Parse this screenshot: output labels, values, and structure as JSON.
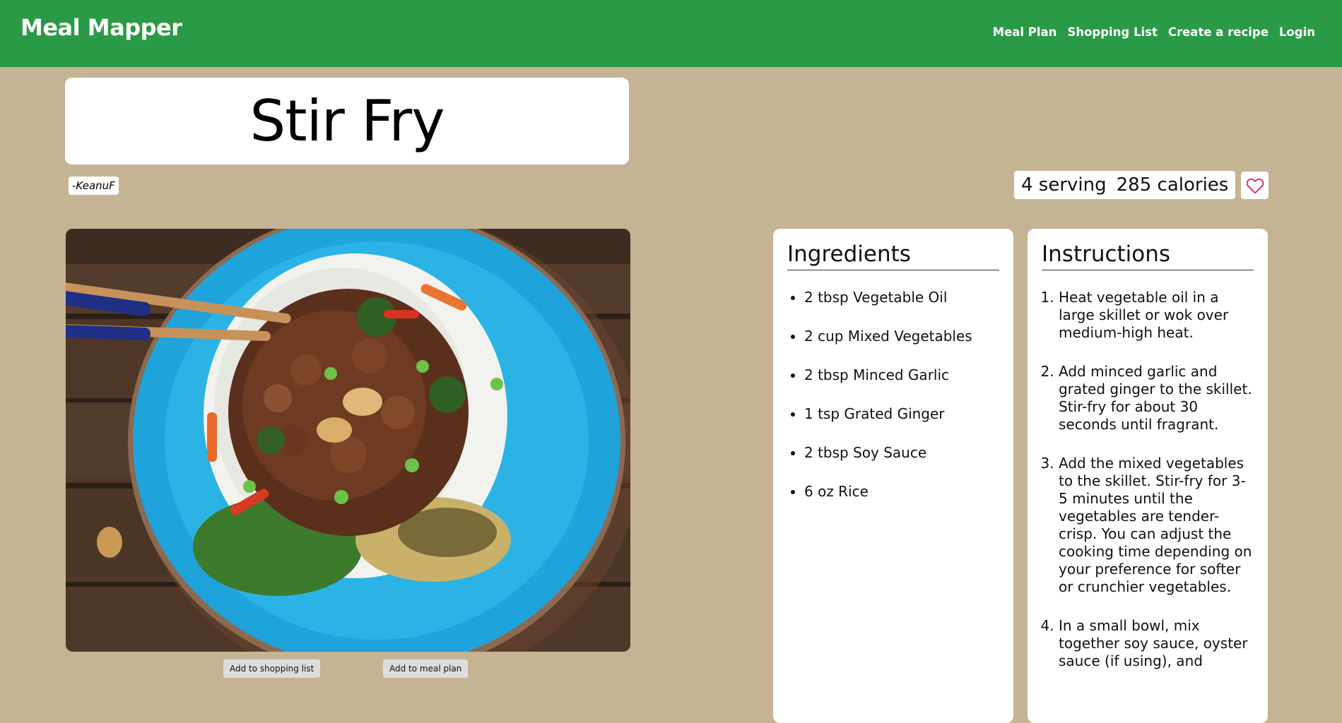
{
  "navbar": {
    "brand": "Meal Mapper",
    "links": [
      "Meal Plan",
      "Shopping List",
      "Create a recipe",
      "Login"
    ]
  },
  "recipe": {
    "title": "Stir Fry",
    "author": "-KeanuF",
    "servings": "4 serving",
    "calories": "285 calories",
    "favorite_icon": "heart-outline-icon",
    "image_alt": "Stir fry with chicken, cashews, vegetables and rice in a blue bowl with chopsticks"
  },
  "actions": {
    "add_shopping": "Add to shopping list",
    "add_meal_plan": "Add to meal plan"
  },
  "ingredients": {
    "heading": "Ingredients",
    "items": [
      "2 tbsp Vegetable Oil",
      "2 cup Mixed Vegetables",
      "2 tbsp Minced Garlic",
      "1 tsp Grated Ginger",
      "2 tbsp Soy Sauce",
      "6 oz Rice"
    ]
  },
  "instructions": {
    "heading": "Instructions",
    "steps": [
      "Heat vegetable oil in a large skillet or wok over medium-high heat.",
      "Add minced garlic and grated ginger to the skillet. Stir-fry for about 30 seconds until fragrant.",
      "Add the mixed vegetables to the skillet. Stir-fry for 3-5 minutes until the vegetables are tender-crisp. You can adjust the cooking time depending on your preference for softer or crunchier vegetables.",
      "In a small bowl, mix together soy sauce, oyster sauce (if using), and"
    ]
  },
  "colors": {
    "navbar": "#2a9a47",
    "background": "#c4b494",
    "heart": "#d6336c"
  }
}
